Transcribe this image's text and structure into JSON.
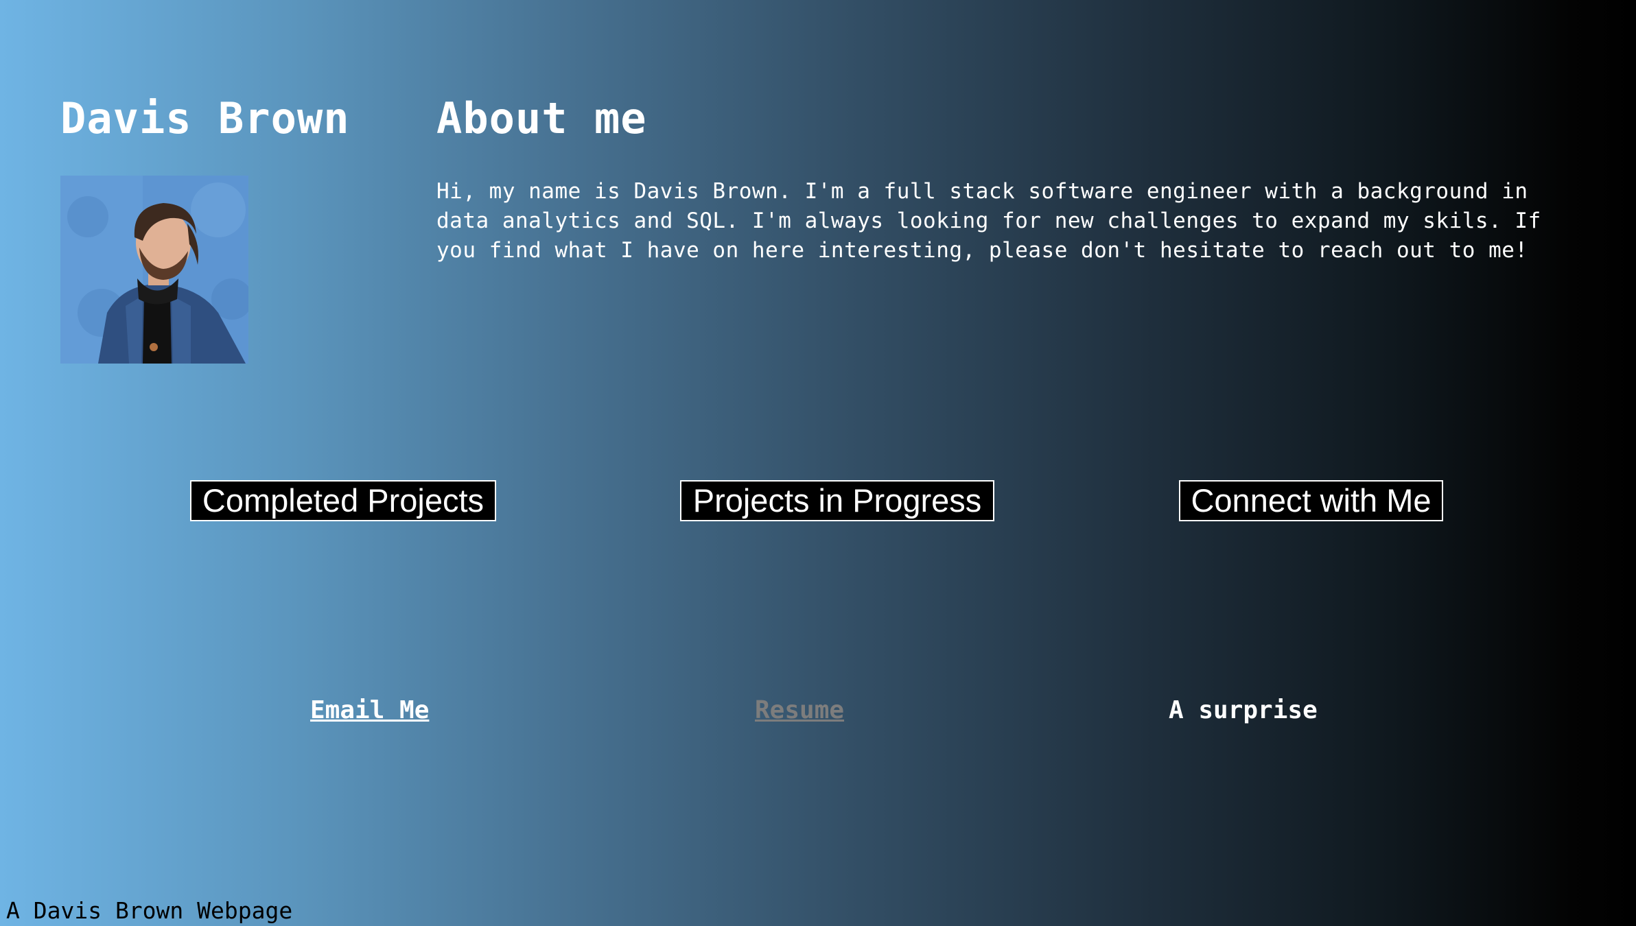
{
  "header": {
    "name": "Davis Brown",
    "about_title": "About me"
  },
  "about": {
    "text": "Hi, my name is Davis Brown. I'm a full stack software engineer with a background in data analytics and SQL. I'm always looking for new challenges to expand my skils. If you find what I have on here interesting, please don't hesitate to reach out to me!"
  },
  "portrait": {
    "description_icon": "profile-photo"
  },
  "nav_buttons": {
    "completed": "Completed Projects",
    "in_progress": "Projects in Progress",
    "connect": "Connect with Me"
  },
  "links": {
    "email": "Email Me",
    "resume": "Resume",
    "surprise": "A surprise"
  },
  "footer": {
    "text": "A Davis Brown Webpage"
  },
  "colors": {
    "gradient_start": "#6fb4e4",
    "gradient_end": "#000000",
    "button_bg": "#000000",
    "visited_link": "#7d7d7d"
  }
}
